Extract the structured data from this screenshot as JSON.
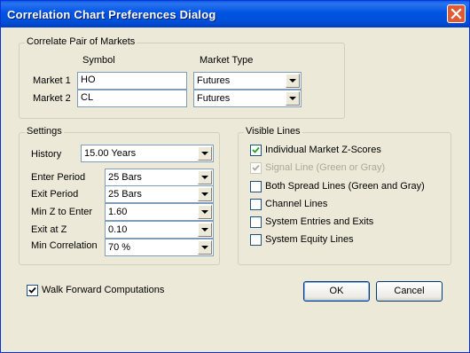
{
  "window": {
    "title": "Correlation Chart Preferences Dialog"
  },
  "markets": {
    "legend": "Correlate Pair of Markets",
    "symbol_header": "Symbol",
    "type_header": "Market Type",
    "rows": [
      {
        "label": "Market 1",
        "symbol": "HO",
        "type": "Futures"
      },
      {
        "label": "Market 2",
        "symbol": "CL",
        "type": "Futures"
      }
    ]
  },
  "settings": {
    "legend": "Settings",
    "history": {
      "label": "History",
      "value": "15.00 Years"
    },
    "enter_period": {
      "label": "Enter Period",
      "value": "25 Bars"
    },
    "exit_period": {
      "label": "Exit Period",
      "value": "25 Bars"
    },
    "min_z": {
      "label": "Min Z to Enter",
      "value": "1.60"
    },
    "exit_z": {
      "label": "Exit at Z",
      "value": "0.10"
    },
    "min_corr": {
      "label": "Min Correlation",
      "value": "70 %"
    }
  },
  "visible_lines": {
    "legend": "Visible Lines",
    "items": [
      {
        "label": "Individual Market Z-Scores",
        "checked": true,
        "enabled": true
      },
      {
        "label": "Signal Line (Green or Gray)",
        "checked": true,
        "enabled": false
      },
      {
        "label": "Both Spread Lines (Green and Gray)",
        "checked": false,
        "enabled": true
      },
      {
        "label": "Channel Lines",
        "checked": false,
        "enabled": true
      },
      {
        "label": "System Entries and Exits",
        "checked": false,
        "enabled": true
      },
      {
        "label": "System Equity Lines",
        "checked": false,
        "enabled": true
      }
    ]
  },
  "walk_forward": {
    "label": "Walk Forward Computations",
    "checked": true
  },
  "buttons": {
    "ok": "OK",
    "cancel": "Cancel"
  },
  "icons": {
    "close": "close-icon",
    "dropdown": "chevron-down-icon",
    "check": "checkmark-icon"
  },
  "colors": {
    "titlebar": "#0054e3",
    "dialog_bg": "#ece9d8",
    "close_button": "#e05a33"
  }
}
